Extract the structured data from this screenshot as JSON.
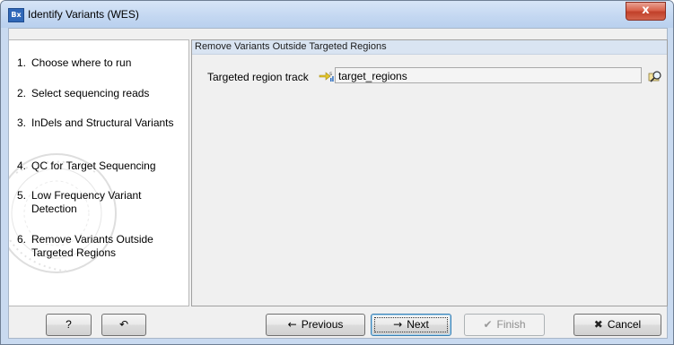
{
  "window": {
    "title": "Identify Variants (WES)",
    "app_icon_text": "Bx",
    "close_label": "x"
  },
  "steps": [
    {
      "num": "1.",
      "label": "Choose where to run"
    },
    {
      "num": "2.",
      "label": "Select sequencing reads"
    },
    {
      "num": "3.",
      "label": "InDels and Structural Variants"
    },
    {
      "num": "4.",
      "label": "QC for Target Sequencing"
    },
    {
      "num": "5.",
      "label": "Low Frequency Variant Detection"
    },
    {
      "num": "6.",
      "label": "Remove Variants Outside Targeted Regions"
    }
  ],
  "active_step": 6,
  "section": {
    "header": "Remove Variants Outside Targeted Regions",
    "field_label": "Targeted region track",
    "field_value": "target_regions",
    "browse_icon": "browse-folder-icon"
  },
  "buttons": {
    "help": "?",
    "reset": "↶",
    "previous": "Previous",
    "next": "Next",
    "finish": "Finish",
    "cancel": "Cancel",
    "previous_icon": "←",
    "next_icon": "→",
    "finish_icon": "✔",
    "cancel_icon": "✖"
  },
  "colors": {
    "title_bar": "#c3d7f1",
    "header_band": "#d9e4f2",
    "close_button": "#c1402a"
  }
}
